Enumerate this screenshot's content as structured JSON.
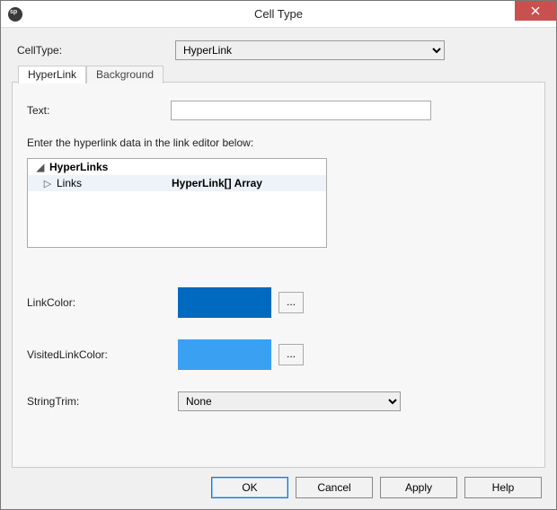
{
  "window": {
    "title": "Cell Type"
  },
  "celltype": {
    "label": "CellType:",
    "value": "HyperLink"
  },
  "tabs": {
    "items": [
      "HyperLink",
      "Background"
    ],
    "active": 0
  },
  "hyperlink": {
    "text_label": "Text:",
    "text_value": "",
    "instruction": "Enter the hyperlink data in the link editor below:",
    "tree": {
      "group": "HyperLinks",
      "child_name": "Links",
      "child_value": "HyperLink[] Array"
    },
    "linkcolor": {
      "label": "LinkColor:",
      "hex": "#006ac1"
    },
    "visitedlinkcolor": {
      "label": "VisitedLinkColor:",
      "hex": "#3aa0f2"
    },
    "ellipsis": "...",
    "stringtrim": {
      "label": "StringTrim:",
      "value": "None"
    }
  },
  "buttons": {
    "ok": "OK",
    "cancel": "Cancel",
    "apply": "Apply",
    "help": "Help"
  }
}
